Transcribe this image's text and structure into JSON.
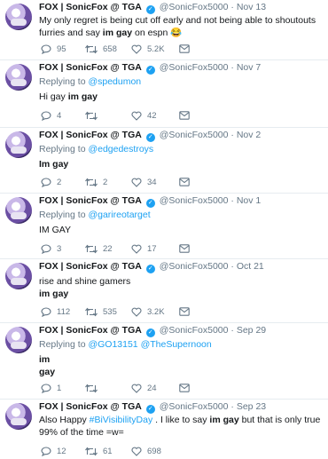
{
  "author": {
    "name": "FOX | SonicFox @ TGA",
    "verified_glyph": "✓",
    "handle": "@SonicFox5000",
    "separator": "·"
  },
  "reply_prefix": "Replying to",
  "tweets": [
    {
      "date": "Nov 13",
      "text_parts": [
        "My only regret is being cut off early and not being able to shoutouts furries and say ",
        "im gay",
        " on espn 😂"
      ],
      "replies": "95",
      "retweets": "658",
      "likes": "5.2K"
    },
    {
      "date": "Nov 7",
      "reply_to": [
        "@spedumon"
      ],
      "text_parts": [
        "Hi gay ",
        "im gay",
        ""
      ],
      "replies": "4",
      "retweets": "",
      "likes": "42"
    },
    {
      "date": "Nov 2",
      "reply_to": [
        "@edgedestroys"
      ],
      "text_parts": [
        "",
        "Im gay",
        ""
      ],
      "replies": "2",
      "retweets": "2",
      "likes": "34"
    },
    {
      "date": "Nov 1",
      "reply_to": [
        "@garireotarget"
      ],
      "text_parts": [
        "IM GAY"
      ],
      "replies": "3",
      "retweets": "22",
      "likes": "17"
    },
    {
      "date": "Oct 21",
      "text_line1": "rise and shine gamers",
      "text_line2_bold": "im gay",
      "replies": "112",
      "retweets": "535",
      "likes": "3.2K"
    },
    {
      "date": "Sep 29",
      "reply_to": [
        "@GO13151",
        "@TheSupernoon"
      ],
      "text_line1_bold": "im",
      "text_line2_bold": "gay",
      "replies": "1",
      "retweets": "",
      "likes": "24"
    },
    {
      "date": "Sep 23",
      "text_parts": [
        "Also Happy ",
        "#BiVisibilityDay",
        " . I like to say ",
        "im gay",
        " but that is only true 99% of the time =w="
      ],
      "replies": "12",
      "retweets": "61",
      "likes": "698"
    }
  ],
  "icons": [
    "reply-icon",
    "retweet-icon",
    "like-icon",
    "dm-icon",
    "verified-icon"
  ],
  "colors": {
    "link": "#1da1f2",
    "muted": "#657786",
    "text": "#14171a",
    "divider": "#e6ecf0"
  }
}
